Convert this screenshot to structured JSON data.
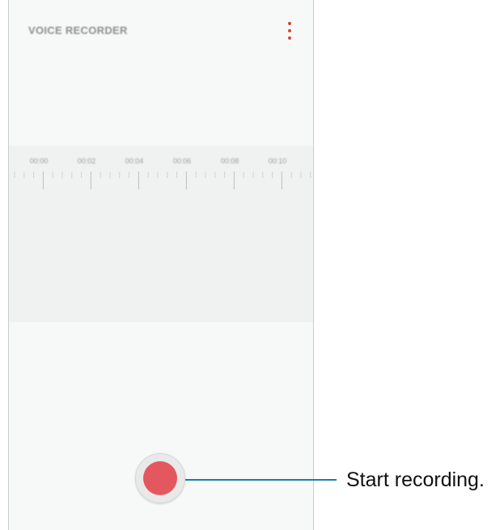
{
  "app": {
    "title": "VOICE RECORDER",
    "menu_icon": "more-vertical-icon",
    "accent_color": "#d2483b"
  },
  "timeline": {
    "labels": [
      "00:00",
      "00:02",
      "00:04",
      "00:06",
      "00:08",
      "00:10"
    ]
  },
  "record_button": {
    "icon": "record-icon",
    "color": "#e3585e"
  },
  "callout": {
    "text": "Start recording.",
    "line_color": "#1a7fa8"
  }
}
